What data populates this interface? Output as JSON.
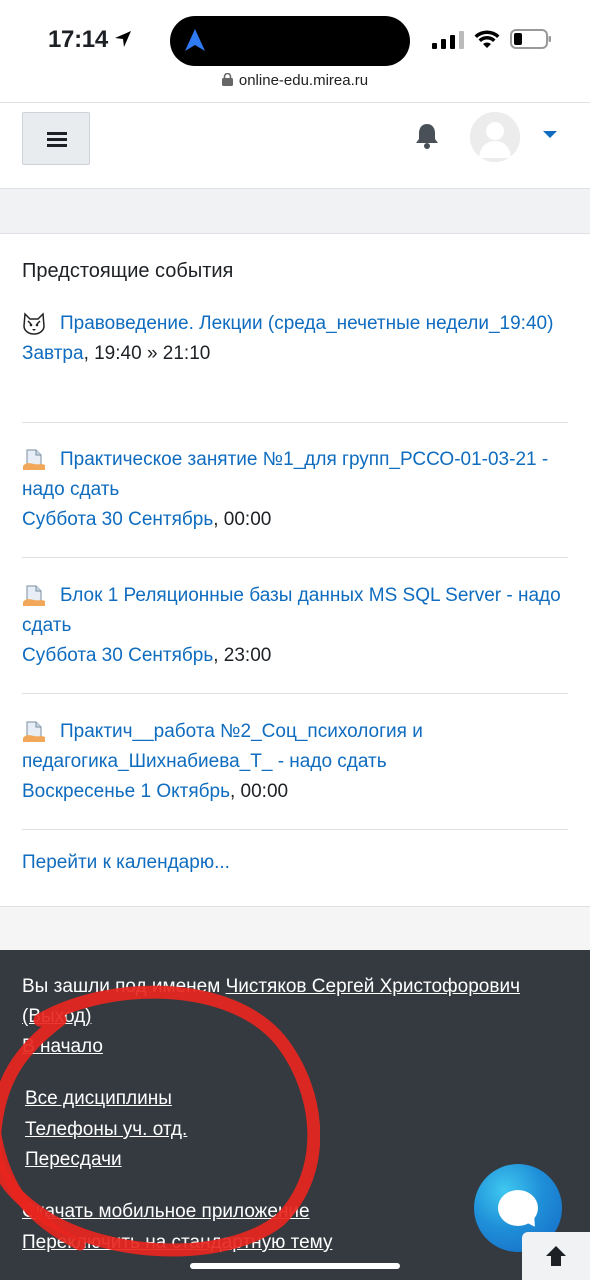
{
  "status_bar": {
    "time": "17:14",
    "url": "online-edu.mirea.ru"
  },
  "navbar": {
    "menu_icon": "hamburger-icon",
    "notification_icon": "bell-icon",
    "avatar_icon": "user-avatar",
    "accent_color": "#0f6cbf"
  },
  "upcoming_events": {
    "title": "Предстоящие события",
    "events": [
      {
        "icon": "husky-icon",
        "name": "Правоведение. Лекции (среда_нечетные недели_19:40)",
        "date": "Завтра",
        "time": ", 19:40 » 21:10"
      },
      {
        "icon": "assignment-icon",
        "name": "Практическое занятие №1_для групп_РССО-01-03-21 - надо сдать",
        "date": "Суббота 30 Сентябрь",
        "time": ", 00:00"
      },
      {
        "icon": "assignment-icon",
        "name": "Блок 1 Реляционные базы данных MS SQL Server - надо сдать",
        "date": "Суббота 30 Сентябрь",
        "time": ", 23:00"
      },
      {
        "icon": "assignment-icon",
        "name": "Практич__работа №2_Соц_психология и педагогика_Шихнабиева_Т_ - надо сдать",
        "date": "Воскресенье 1 Октябрь",
        "time": ", 00:00"
      }
    ],
    "goto_calendar": "Перейти к календарю..."
  },
  "footer": {
    "logged_in_prefix": "Вы зашли под именем",
    "user_name": "Чистяков Сергей Христофорович",
    "logout": "(Выход)",
    "home": "В начало",
    "links": [
      "Все дисциплины",
      "Телефоны уч. отд.",
      "Пересдачи"
    ],
    "mobile_app": "Скачать мобильное приложение",
    "switch_theme": "Переключить на стандартную тему",
    "background_color": "#343a40"
  },
  "floating": {
    "chat_icon": "chat-bubble-icon",
    "back_to_top_icon": "arrow-up-icon"
  }
}
